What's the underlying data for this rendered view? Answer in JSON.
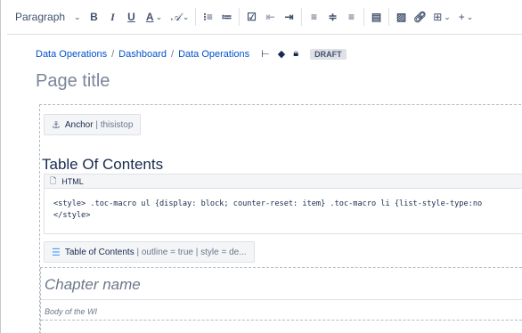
{
  "toolbar": {
    "paragraph_label": "Paragraph",
    "buttons": [
      {
        "name": "bold-button",
        "glyph": "B"
      },
      {
        "name": "italic-button",
        "glyph": "I"
      },
      {
        "name": "underline-button",
        "glyph": "U"
      },
      {
        "name": "text-color-button",
        "glyph": "A"
      },
      {
        "name": "clear-format-button",
        "glyph": "Ⱥ"
      },
      {
        "name": "bullet-list-button",
        "glyph": "☰"
      },
      {
        "name": "numbered-list-button",
        "glyph": "☷"
      },
      {
        "name": "task-list-button",
        "glyph": "☑"
      },
      {
        "name": "outdent-button",
        "glyph": "⇤"
      },
      {
        "name": "indent-button",
        "glyph": "⇥"
      },
      {
        "name": "align-left-button",
        "glyph": "≡"
      },
      {
        "name": "align-center-button",
        "glyph": "≣"
      },
      {
        "name": "align-right-button",
        "glyph": "☰"
      },
      {
        "name": "layout-button",
        "glyph": "▣"
      },
      {
        "name": "image-button",
        "glyph": "▧"
      },
      {
        "name": "link-button",
        "glyph": "∞"
      },
      {
        "name": "table-button",
        "glyph": "⊞"
      },
      {
        "name": "insert-more-button",
        "glyph": "+"
      }
    ]
  },
  "breadcrumbs": {
    "items": [
      "Data Operations",
      "Dashboard",
      "Data Operations"
    ],
    "separator": "/",
    "status": "DRAFT"
  },
  "page": {
    "title_placeholder": "Page title"
  },
  "content": {
    "anchor_macro": {
      "name": "Anchor",
      "param": "thisistop"
    },
    "toc_heading": "Table Of Contents",
    "html_macro": {
      "name": "HTML",
      "code_line_1": "<style> .toc-macro ul {display: block; counter-reset: item} .toc-macro li {list-style-type:no",
      "code_line_2": "</style>"
    },
    "toc_macro": {
      "name": "Table of Contents",
      "param": "outline = true | style = de..."
    },
    "chapter": {
      "title": "Chapter name",
      "body": "Body of the WI"
    }
  },
  "colors": {
    "link": "#0052cc",
    "text": "#172b4d",
    "muted": "#6b778c",
    "border": "#dfe1e6"
  }
}
